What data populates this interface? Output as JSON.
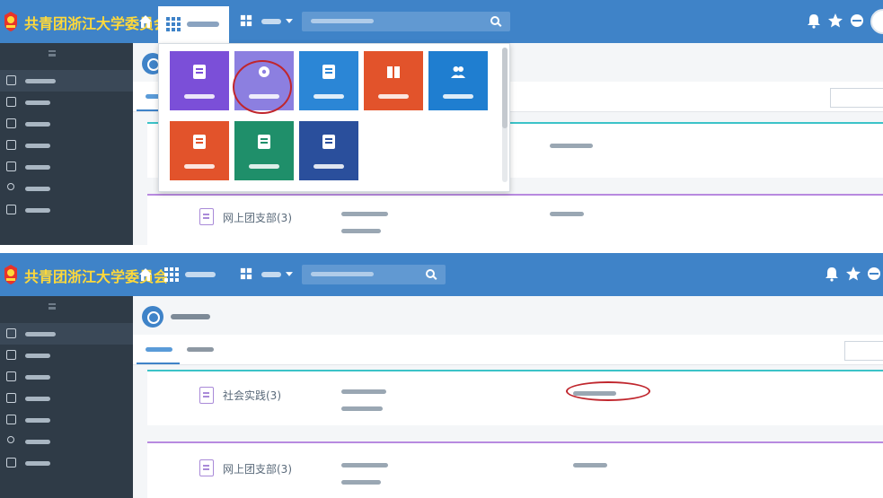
{
  "colors": {
    "header_blue": "#3f83c8",
    "sidebar_dark": "#2f3b47",
    "logo_yellow": "#ffd93a",
    "highlight_red": "#c0262d",
    "section1_line": "#3cc3c8",
    "section2_line": "#b88ae0",
    "tile_purple": "#7b4fd8",
    "tile_violet": "#8c7fe0",
    "tile_blue": "#2b86d6",
    "tile_orange": "#e2532b",
    "tile_skyblue": "#1f7ed0",
    "tile_green": "#1f8f6a",
    "tile_navy": "#2a4f9c"
  },
  "header": {
    "org_name": "共青团浙江大学委员会",
    "home_icon": "home-icon",
    "apps_icon": "grid-icon",
    "nav_active_label": "",
    "nav_second_label": "",
    "search_placeholder": "",
    "right_icons": [
      "bell-icon",
      "star-icon",
      "globe-icon"
    ]
  },
  "sidebar": {
    "items": [
      {
        "icon": "new-process-icon",
        "label": ""
      },
      {
        "icon": "todo-icon",
        "label": ""
      },
      {
        "icon": "done-icon",
        "label": ""
      },
      {
        "icon": "my-request-icon",
        "label": ""
      },
      {
        "icon": "print-icon",
        "label": ""
      },
      {
        "icon": "search-icon",
        "label": ""
      },
      {
        "icon": "copy-icon",
        "label": ""
      }
    ]
  },
  "main": {
    "page_title": "",
    "tabs": [
      {
        "label": "",
        "active": true
      },
      {
        "label": "",
        "active": false
      }
    ],
    "sections": [
      {
        "title": "社会实践(3)",
        "links": [
          "",
          ""
        ],
        "right_link": ""
      },
      {
        "title": "网上团支部(3)",
        "links": [
          "",
          ""
        ],
        "right_link": ""
      }
    ]
  },
  "dropdown": {
    "tiles": [
      {
        "icon": "document-icon",
        "label": "",
        "color": "#7b4fd8"
      },
      {
        "icon": "gear-icon",
        "label": "",
        "color": "#8c7fe0",
        "highlighted": true
      },
      {
        "icon": "document-icon",
        "label": "",
        "color": "#2b86d6"
      },
      {
        "icon": "book-icon",
        "label": "",
        "color": "#e2532b"
      },
      {
        "icon": "users-icon",
        "label": "",
        "color": "#1f7ed0"
      },
      {
        "icon": "document-icon",
        "label": "",
        "color": "#e2532b"
      },
      {
        "icon": "document-icon",
        "label": "",
        "color": "#1f8f6a"
      },
      {
        "icon": "document-icon",
        "label": "",
        "color": "#2a4f9c"
      }
    ]
  }
}
